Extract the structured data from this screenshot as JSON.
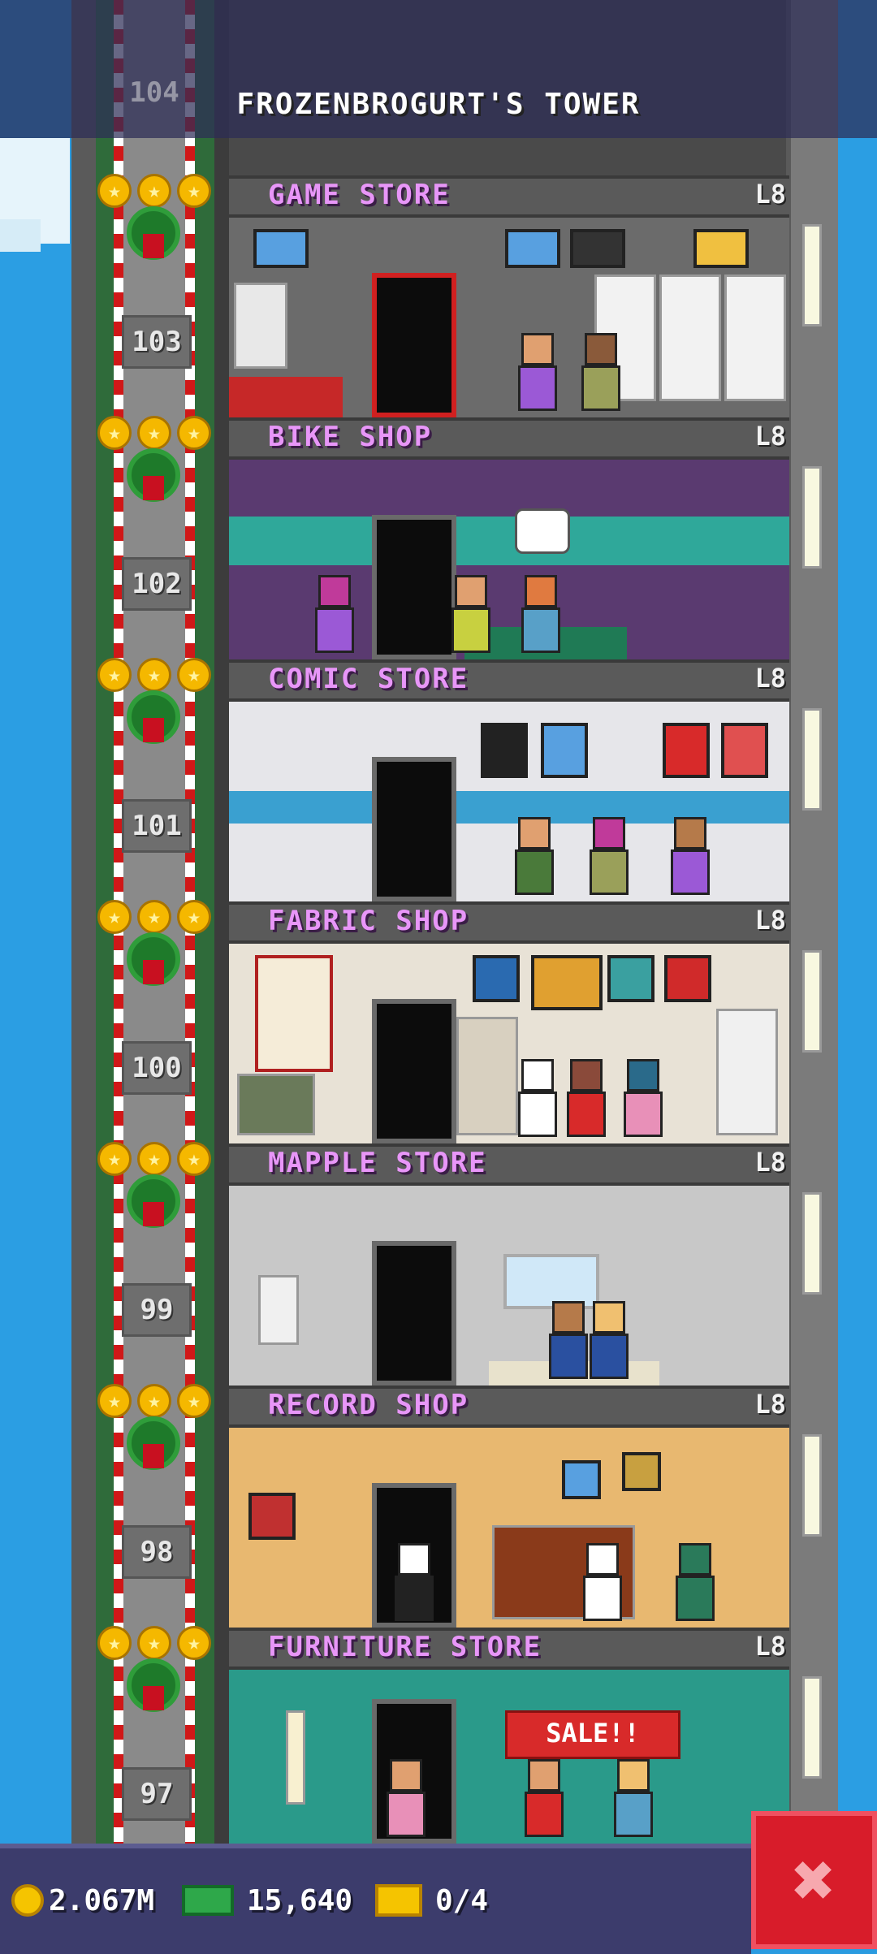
{
  "header": {
    "title": "FROZENBROGURT'S TOWER",
    "top_floor_number": "104"
  },
  "floors": [
    {
      "name": "GAME STORE",
      "level": "L8",
      "number": "103"
    },
    {
      "name": "BIKE SHOP",
      "level": "L8",
      "number": "102"
    },
    {
      "name": "COMIC STORE",
      "level": "L8",
      "number": "101"
    },
    {
      "name": "FABRIC SHOP",
      "level": "L8",
      "number": "100"
    },
    {
      "name": "MAPPLE STORE",
      "level": "L8",
      "number": "99"
    },
    {
      "name": "RECORD SHOP",
      "level": "L8",
      "number": "98"
    },
    {
      "name": "FURNITURE STORE",
      "level": "L8",
      "number": "97"
    }
  ],
  "signs": {
    "sale": "SALE!!"
  },
  "status_bar": {
    "coins": "2.067M",
    "bux": "15,640",
    "tickets": "0/4"
  },
  "close_button": {
    "label": "✖"
  },
  "colors": {
    "floor_label": "#e896f8",
    "sky": "#2b9ee3",
    "close_button": "#d81c2a",
    "status_bar": "#3c3c6c"
  },
  "icons": {
    "coin": "coin-icon",
    "bux": "bux-icon",
    "ticket": "ticket-icon",
    "close": "close-icon",
    "star": "star-icon",
    "wreath": "wreath-icon"
  }
}
